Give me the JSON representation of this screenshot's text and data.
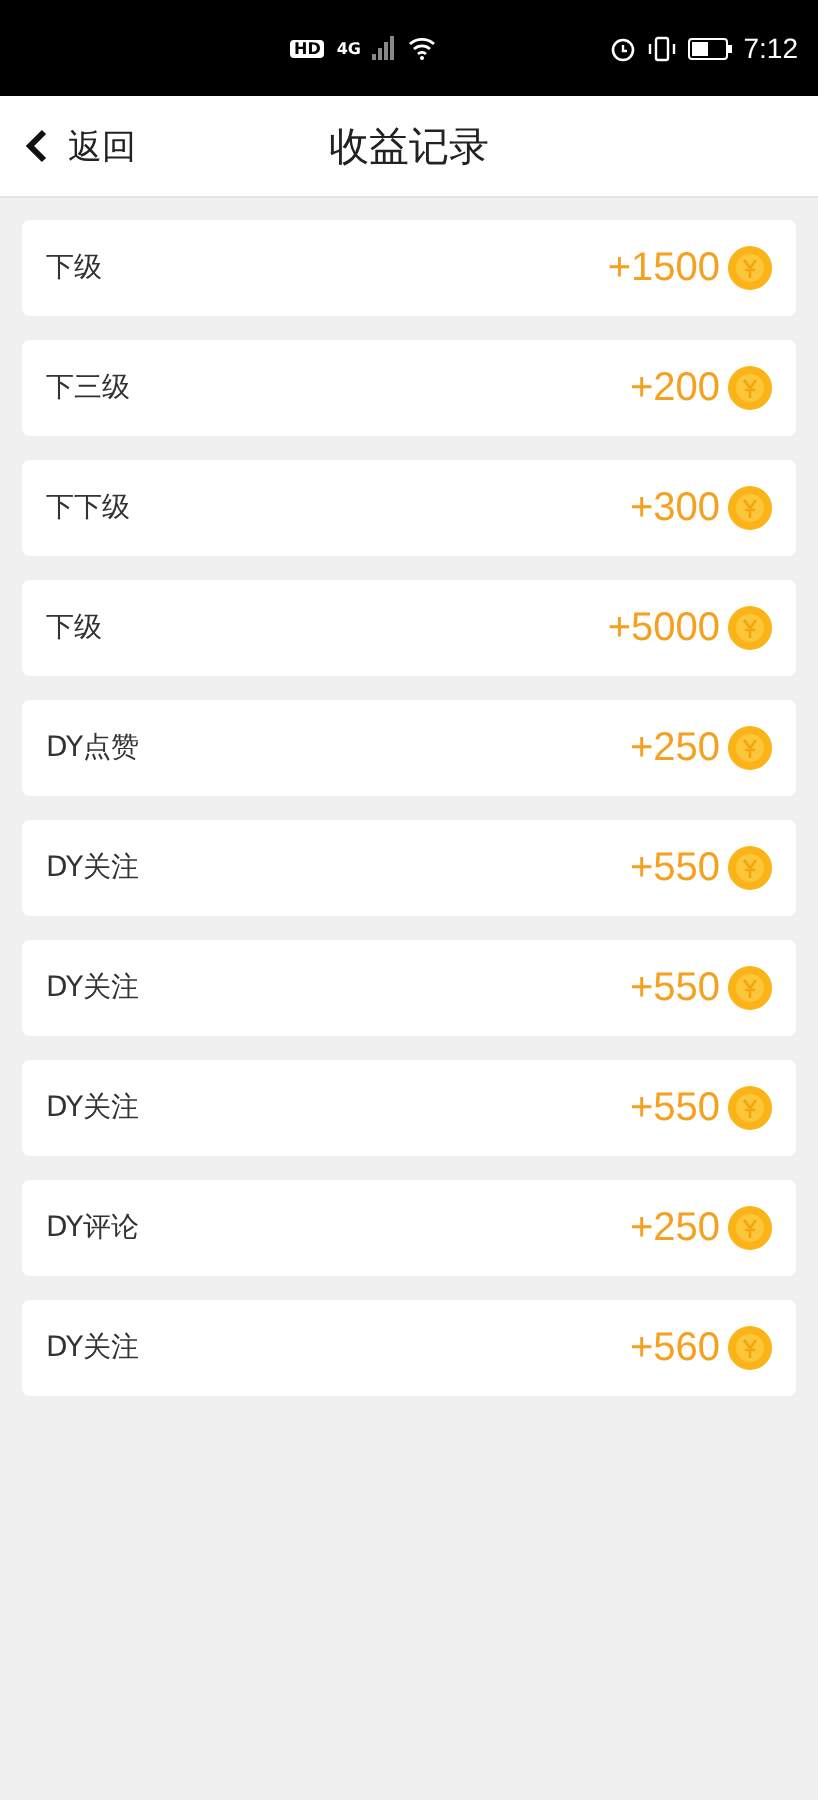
{
  "status_bar": {
    "hd": "HD",
    "network": "4G",
    "time": "7:12"
  },
  "header": {
    "back": "返回",
    "title": "收益记录"
  },
  "records": [
    {
      "label": "下级",
      "amount": "+1500"
    },
    {
      "label": "下三级",
      "amount": "+200"
    },
    {
      "label": "下下级",
      "amount": "+300"
    },
    {
      "label": "下级",
      "amount": "+5000"
    },
    {
      "label": "DY点赞",
      "amount": "+250"
    },
    {
      "label": "DY关注",
      "amount": "+550"
    },
    {
      "label": "DY关注",
      "amount": "+550"
    },
    {
      "label": "DY关注",
      "amount": "+550"
    },
    {
      "label": "DY评论",
      "amount": "+250"
    },
    {
      "label": "DY关注",
      "amount": "+560"
    }
  ]
}
